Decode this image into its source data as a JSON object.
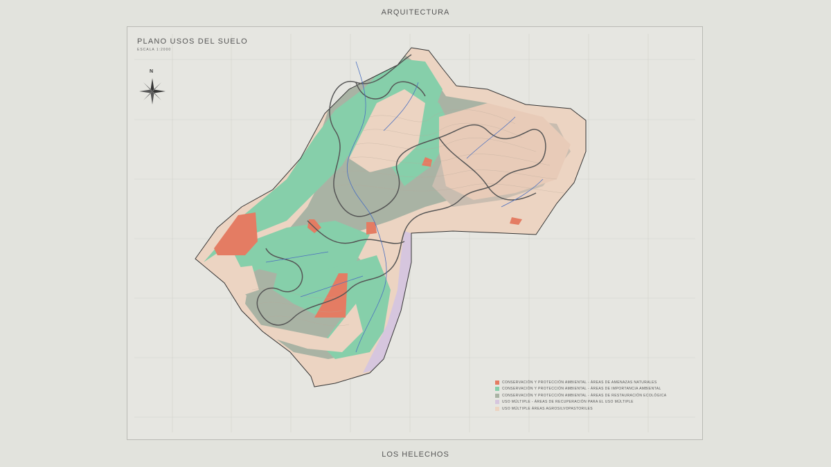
{
  "header": {
    "top_label": "ARQUITECTURA",
    "bottom_label": "LOS HELECHOS"
  },
  "map": {
    "title": "PLANO USOS DEL SUELO",
    "scale": "ESCALA 1:2000",
    "north": "N"
  },
  "legend": {
    "items": [
      {
        "label": "CONSERVACIÓN Y PROTECCIÓN AMBIENTAL - ÁREAS DE AMENAZAS NATURALES",
        "color": "#e47c63"
      },
      {
        "label": "CONSERVACIÓN Y PROTECCIÓN AMBIENTAL - ÁREAS DE IMPORTANCIA AMBIENTAL",
        "color": "#86cfaa"
      },
      {
        "label": "CONSERVACIÓN Y PROTECCIÓN AMBIENTAL - ÁREAS DE RESTAURACIÓN ECOLÓGICA",
        "color": "#a9b3a4"
      },
      {
        "label": "USO MÚLTIPLE - ÁREAS DE RECUPERACIÓN PARA EL USO MÚLTIPLE",
        "color": "#d6c6de"
      },
      {
        "label": "USO MÚLTIPLE ÁREAS AGROSILVOPASTORILES",
        "color": "#ecd4c2"
      }
    ]
  },
  "colors": {
    "background": "#e2e3dd",
    "amenazas": "#e47c63",
    "importancia": "#86cfaa",
    "restauracion": "#a9b3a4",
    "recuperacion": "#d6c6de",
    "agro": "#ecd4c2",
    "river": "#4a6fc0",
    "road": "#555555"
  }
}
